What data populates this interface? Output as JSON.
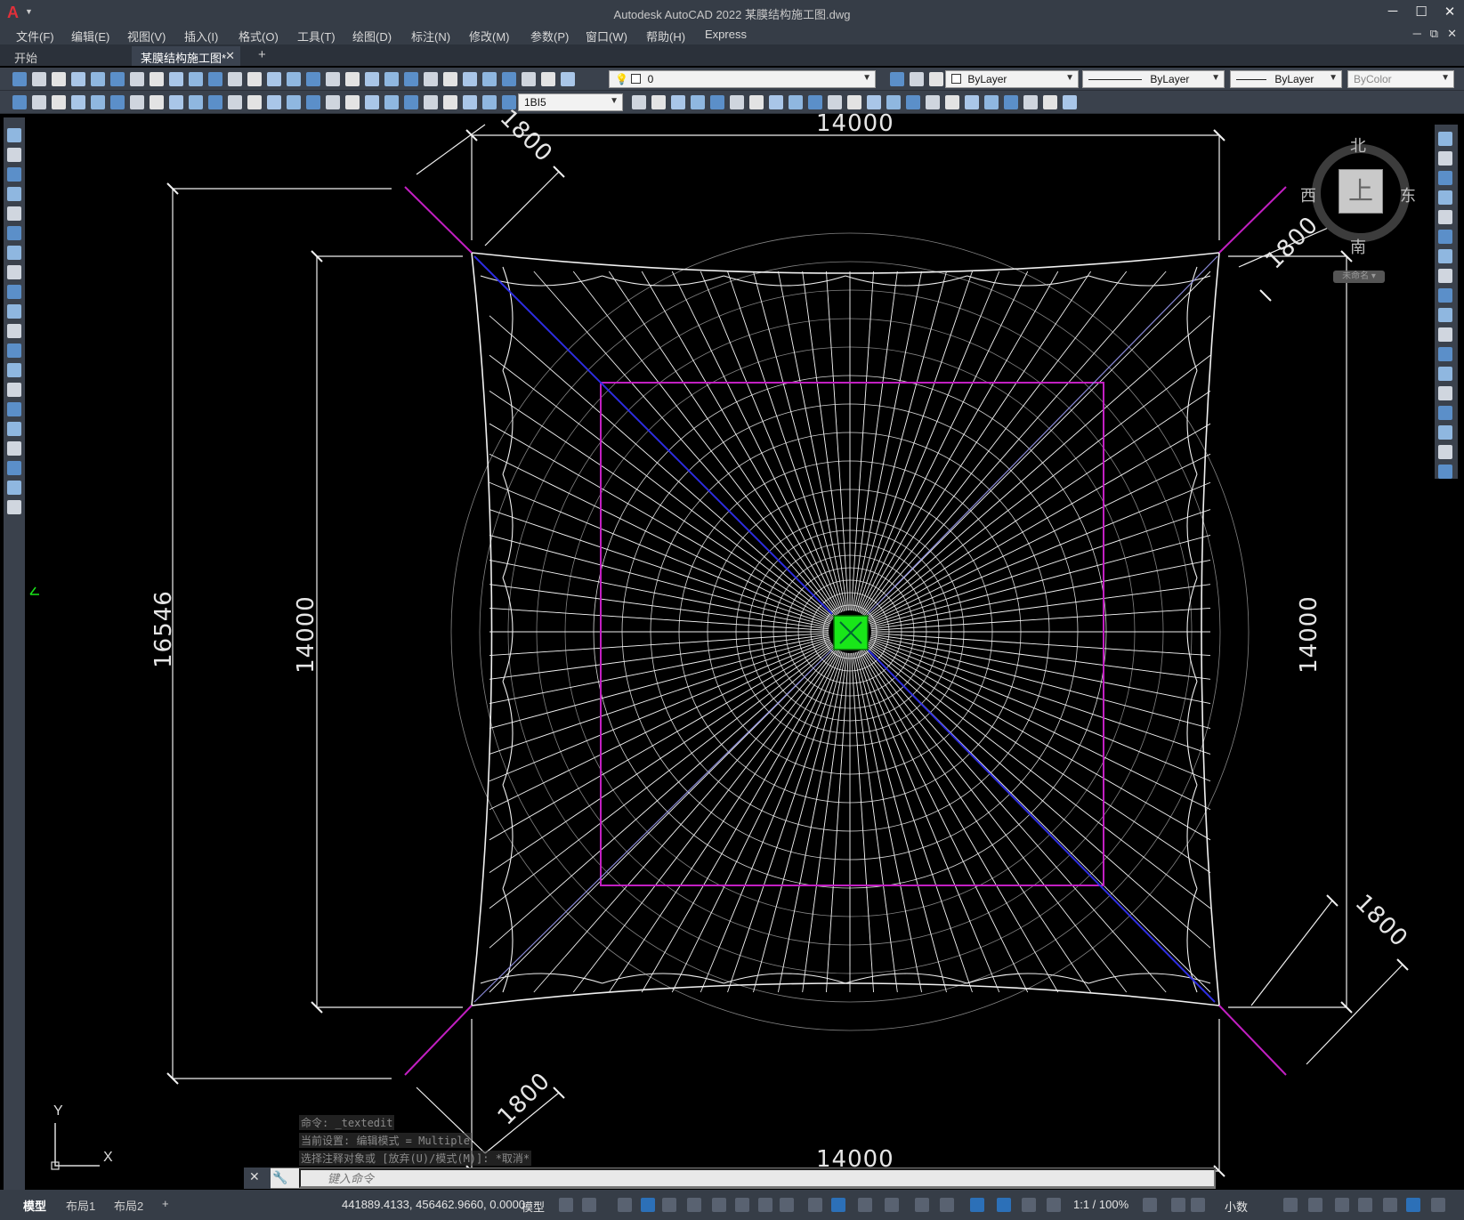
{
  "window": {
    "title": "Autodesk AutoCAD 2022    某膜结构施工图.dwg",
    "buttons": [
      "─",
      "☐",
      "✕"
    ],
    "mdi_buttons": [
      "─",
      "⧉",
      "✕"
    ]
  },
  "menu": [
    "文件(F)",
    "编辑(E)",
    "视图(V)",
    "插入(I)",
    "格式(O)",
    "工具(T)",
    "绘图(D)",
    "标注(N)",
    "修改(M)",
    "参数(P)",
    "窗口(W)",
    "帮助(H)",
    "Express"
  ],
  "tabs": {
    "start": "开始",
    "active": "某膜结构施工图*",
    "close": "✕",
    "add": "+"
  },
  "toolbar": {
    "layer_value": "0",
    "color_value": "ByLayer",
    "linetype_value": "ByLayer",
    "lineweight_value": "ByLayer",
    "plotstyle_value": "ByColor",
    "dimstyle_value": "1BI5"
  },
  "drawing": {
    "dims": {
      "top_width": "14000",
      "bottom_width": "14000",
      "left_outer": "16546",
      "left_inner": "14000",
      "right_height": "14000",
      "corner_tl": "1800",
      "corner_tr": "1800",
      "corner_br": "1800",
      "corner_bl": "1800"
    },
    "ucs": {
      "y": "Y",
      "x": "X"
    },
    "colors": {
      "mesh": "#f0f0f0",
      "magenta": "#c21fc2",
      "blue": "#2d2de0",
      "green": "#19e619"
    }
  },
  "viewcube": {
    "north": "北",
    "south": "南",
    "east": "东",
    "west": "西",
    "face": "上",
    "wcs": "未命名 ▾"
  },
  "command": {
    "history": [
      "命令: _textedit",
      "当前设置: 编辑模式 = Multiple",
      "选择注释对象或 [放弃(U)/模式(M)]: *取消*"
    ],
    "placeholder": "键入命令"
  },
  "status": {
    "layouts": [
      "模型",
      "布局1",
      "布局2"
    ],
    "add_layout": "+",
    "coordinates": "441889.4133, 456462.9660, 0.0000",
    "space": "模型",
    "scale": "1:1 / 100%",
    "units": "小数"
  }
}
